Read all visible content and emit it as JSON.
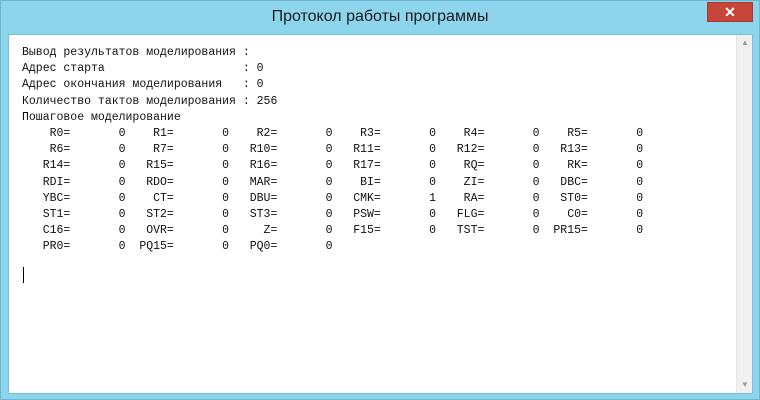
{
  "window": {
    "title": "Протокол работы программы",
    "close_icon": "✕"
  },
  "output": {
    "text": "Вывод результатов моделирования :\nАдрес старта                    : 0\nАдрес окончания моделирования   : 0\nКоличество тактов моделирования : 256\nПошаговое моделирование\n    R0=       0    R1=       0    R2=       0    R3=       0    R4=       0    R5=       0\n    R6=       0    R7=       0   R10=       0   R11=       0   R12=       0   R13=       0\n   R14=       0   R15=       0   R16=       0   R17=       0    RQ=       0    RK=       0\n   RDI=       0   RDO=       0   MAR=       0    BI=       0    ZI=       0   DBC=       0\n   YBC=       0    CT=       0   DBU=       0   CMK=       1    RA=       0   ST0=       0\n   ST1=       0   ST2=       0   ST3=       0   PSW=       0   FLG=       0    C0=       0\n   C16=       0   OVR=       0     Z=       0   F15=       0   TST=       0  PR15=       0\n   PR0=       0  PQ15=       0   PQ0=       0"
  },
  "scrollbar": {
    "up_icon": "▲",
    "down_icon": "▼"
  }
}
